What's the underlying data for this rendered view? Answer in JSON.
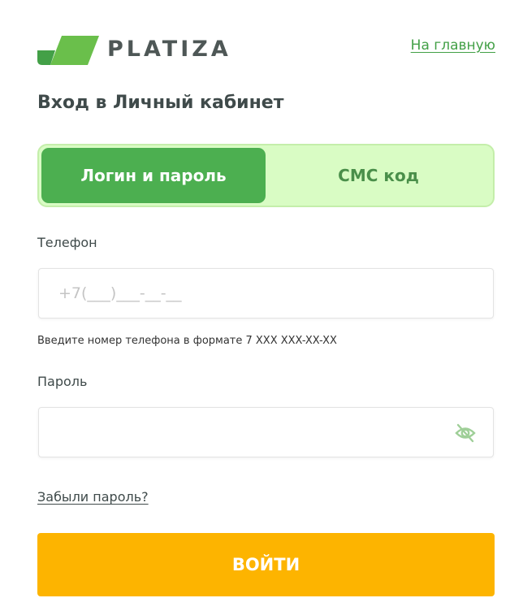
{
  "header": {
    "brand": "PLATIZA",
    "home_link": "На главную",
    "logo_icon": "platiza-leaf-logo-icon"
  },
  "page": {
    "title": "Вход в Личный кабинет"
  },
  "tabs": [
    {
      "label": "Логин и пароль",
      "active": true
    },
    {
      "label": "СМС код",
      "active": false
    }
  ],
  "phone": {
    "label": "Телефон",
    "placeholder": "+7(___)___-__-__",
    "value": "",
    "hint": "Введите номер телефона в формате 7 XXX XXX-XX-XX"
  },
  "password": {
    "label": "Пароль",
    "value": "",
    "toggle_icon": "eye-off-icon"
  },
  "forgot_link": "Забыли пароль?",
  "submit_label": "ВОЙТИ",
  "colors": {
    "brand_green": "#4caf50",
    "tab_bg": "#d9fcc4",
    "tab_inactive_text": "#4a8f4a",
    "button": "#fdb400",
    "text": "#3f4a4a"
  }
}
